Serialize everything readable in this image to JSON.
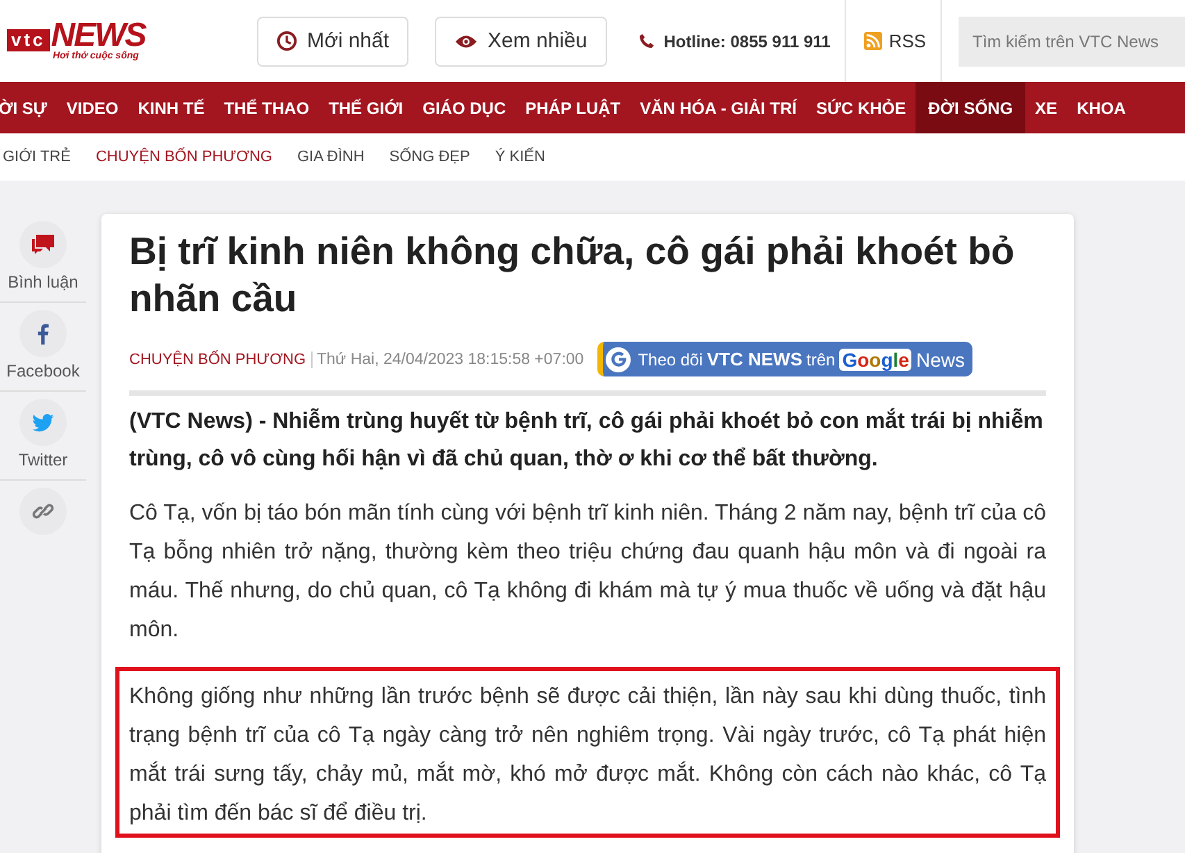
{
  "header": {
    "logo": {
      "brand": "vtc",
      "news": "NEWS",
      "tagline": "Hơi thở cuộc sống"
    },
    "buttons": [
      {
        "label": "Mới nhất",
        "kind": "clock"
      },
      {
        "label": "Xem nhiều",
        "kind": "eye"
      }
    ],
    "hotline": "Hotline: 0855 911 911",
    "rss": "RSS",
    "search": {
      "placeholder": "Tìm kiếm trên VTC News"
    }
  },
  "nav": [
    {
      "label": "ỜI SỰ",
      "selected": false
    },
    {
      "label": "VIDEO",
      "selected": false
    },
    {
      "label": "KINH TẾ",
      "selected": false
    },
    {
      "label": "THỂ THAO",
      "selected": false
    },
    {
      "label": "THẾ GIỚI",
      "selected": false
    },
    {
      "label": "GIÁO DỤC",
      "selected": false
    },
    {
      "label": "PHÁP LUẬT",
      "selected": false
    },
    {
      "label": "VĂN HÓA - GIẢI TRÍ",
      "selected": false
    },
    {
      "label": "SỨC KHỎE",
      "selected": false
    },
    {
      "label": "ĐỜI SỐNG",
      "selected": true
    },
    {
      "label": "XE",
      "selected": false
    },
    {
      "label": "KHOA",
      "selected": false
    }
  ],
  "subnav": [
    {
      "label": "GIỚI TRẺ",
      "selected": false
    },
    {
      "label": "CHUYỆN BỐN PHƯƠNG",
      "selected": true
    },
    {
      "label": "GIA ĐÌNH",
      "selected": false
    },
    {
      "label": "SỐNG ĐẸP",
      "selected": false
    },
    {
      "label": "Ý KIẾN",
      "selected": false
    }
  ],
  "share": [
    {
      "label": "Bình luận",
      "kind": "comment"
    },
    {
      "label": "Facebook",
      "kind": "facebook"
    },
    {
      "label": "Twitter",
      "kind": "twitter"
    },
    {
      "kind": "link"
    }
  ],
  "article": {
    "title": "Bị trĩ kinh niên không chữa, cô gái phải khoét bỏ nhãn cầu",
    "category": "CHUYỆN BỐN PHƯƠNG",
    "date": "Thứ Hai, 24/04/2023 18:15:58 +07:00",
    "follow": {
      "prefix": "Theo dõi",
      "brand": "VTC NEWS",
      "middle": "trên",
      "google": "Google",
      "news": "News"
    },
    "lead": "(VTC News) - Nhiễm trùng huyết từ bệnh trĩ, cô gái phải khoét bỏ con mắt trái bị nhiễm trùng, cô vô cùng hối hận vì đã chủ quan, thờ ơ khi cơ thể bất thường.",
    "paragraphs": [
      {
        "text": "Cô Tạ, vốn bị táo bón mãn tính cùng với bệnh trĩ kinh niên. Tháng 2 năm nay, bệnh trĩ của cô Tạ bỗng nhiên trở nặng, thường kèm theo triệu chứng đau quanh hậu môn và đi ngoài ra máu. Thế nhưng, do chủ quan, cô Tạ không đi khám mà tự ý mua thuốc về uống và đặt hậu môn.",
        "highlighted": false
      },
      {
        "text": "Không giống như những lần trước bệnh sẽ được cải thiện, lần này sau khi dùng thuốc, tình trạng bệnh trĩ của cô Tạ ngày càng trở nên nghiêm trọng. Vài ngày trước, cô Tạ phát hiện mắt trái sưng tấy, chảy mủ, mắt mờ, khó mở được mắt. Không còn cách nào khác, cô Tạ phải tìm đến bác sĩ để điều trị.",
        "highlighted": true
      }
    ]
  }
}
